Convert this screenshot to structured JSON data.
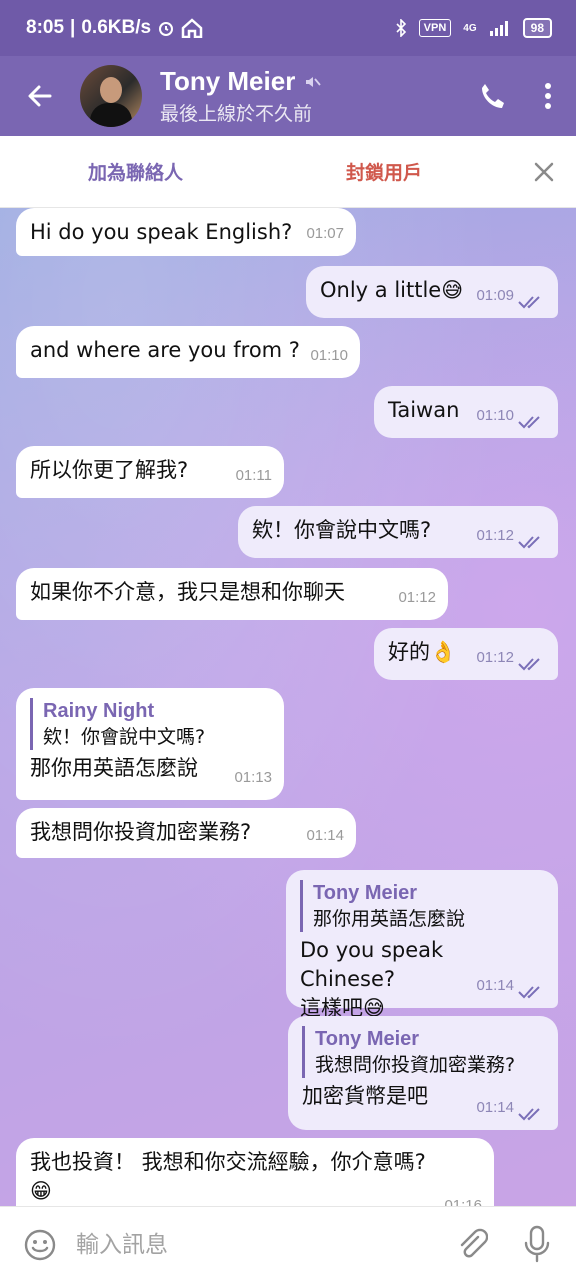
{
  "status": {
    "time": "8:05",
    "speed": "0.6KB/s",
    "vpn": "VPN",
    "net": "4G",
    "battery": "98"
  },
  "header": {
    "name": "Tony Meier",
    "status": "最後上線於不久前"
  },
  "actionbar": {
    "add_contact": "加為聯絡人",
    "block_user": "封鎖用戶"
  },
  "messages": [
    {
      "dir": "in",
      "text": "Hi do you speak English?",
      "time": "01:07"
    },
    {
      "dir": "out",
      "text": "Only a little😅",
      "time": "01:09"
    },
    {
      "dir": "in",
      "text": "and where are you from ?",
      "time": "01:10"
    },
    {
      "dir": "out",
      "text": "Taiwan",
      "time": "01:10"
    },
    {
      "dir": "in",
      "text": "所以你更了解我?",
      "time": "01:11"
    },
    {
      "dir": "out",
      "text": "欸！你會說中文嗎?",
      "time": "01:12"
    },
    {
      "dir": "in",
      "text": "如果你不介意，我只是想和你聊天",
      "time": "01:12"
    },
    {
      "dir": "out",
      "text": "好的👌",
      "time": "01:12"
    },
    {
      "dir": "in",
      "quote_name": "Rainy Night",
      "quote_text": "欸！你會說中文嗎?",
      "text": "那你用英語怎麼說",
      "time": "01:13"
    },
    {
      "dir": "in",
      "text": "我想問你投資加密業務?",
      "time": "01:14"
    },
    {
      "dir": "out",
      "quote_name": "Tony Meier",
      "quote_text": "那你用英語怎麼說",
      "text": "Do you speak Chinese?",
      "text2": "這樣吧😅",
      "time": "01:14"
    },
    {
      "dir": "out",
      "quote_name": "Tony Meier",
      "quote_text": "我想問你投資加密業務?",
      "text": "加密貨幣是吧",
      "time": "01:14"
    },
    {
      "dir": "in",
      "text": "我也投資！ 我想和你交流經驗，你介意嗎?",
      "text2": "😁",
      "time": "01:16"
    }
  ],
  "composer": {
    "placeholder": "輸入訊息"
  },
  "colors": {
    "header": "#7a66b2",
    "statusbar": "#6f5aa8",
    "accent": "#7a66b2",
    "danger": "#d0584c"
  },
  "icons": [
    "back-arrow-icon",
    "mute-icon",
    "phone-icon",
    "more-vert-icon",
    "close-icon",
    "double-check-icon",
    "emoji-icon",
    "attach-icon",
    "mic-icon",
    "bluetooth-icon",
    "signal-icon",
    "battery-icon"
  ]
}
